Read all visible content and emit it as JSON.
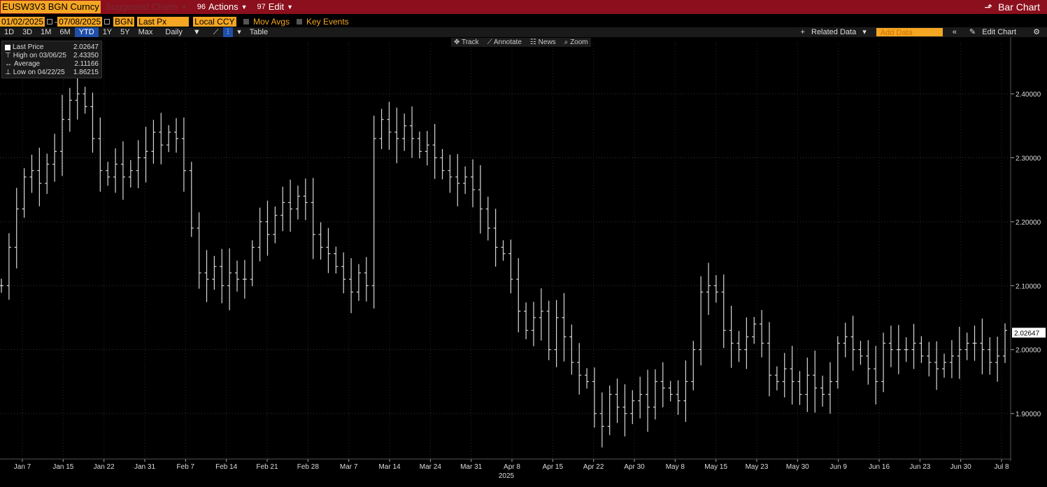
{
  "titlebar": {
    "security": "EUSW3V3 BGN Curncy",
    "suggested": "Suggested Charts",
    "actions_num": "96",
    "actions": "Actions",
    "edit_num": "97",
    "edit": "Edit",
    "bar_chart": "Bar Chart"
  },
  "controls": {
    "start_date": "01/02/2025",
    "end_date": "07/08/2025",
    "source": "BGN",
    "field": "Last Px",
    "currency": "Local CCY",
    "mov_avgs": "Mov Avgs",
    "key_events": "Key Events"
  },
  "periods": [
    "1D",
    "3D",
    "1M",
    "6M",
    "YTD",
    "1Y",
    "5Y",
    "Max"
  ],
  "active_period": "YTD",
  "frequency": "Daily",
  "table_label": "Table",
  "related_data": "Related Data",
  "add_data_placeholder": "Add Data",
  "edit_chart": "Edit Chart",
  "chart_tools": [
    "Track",
    "Annotate",
    "News",
    "Zoom"
  ],
  "legend": {
    "last_label": "Last Price",
    "last_value": "2.02647",
    "high_label": "High on 03/06/25",
    "high_value": "2.43350",
    "avg_label": "Average",
    "avg_value": "2.11166",
    "low_label": "Low on 04/22/25",
    "low_value": "1.86215"
  },
  "colors": {
    "title_bar": "#8b0f1c",
    "accent": "#f5a623",
    "bars": "#d8d8d8",
    "active_tab": "#1f4fa8"
  },
  "chart_data": {
    "type": "bar",
    "style": "ohlc",
    "ylim": [
      1.83,
      2.48
    ],
    "yticks": [
      "1.90000",
      "2.00000",
      "2.10000",
      "2.20000",
      "2.30000",
      "2.40000"
    ],
    "last_price_label": "2.02647",
    "xlabels": [
      "Jan 7",
      "Jan 15",
      "Jan 22",
      "Jan 31",
      "Feb 7",
      "Feb 14",
      "Feb 21",
      "Feb 28",
      "Mar 7",
      "Mar 14",
      "Mar 24",
      "Mar 31",
      "Apr 8",
      "Apr 15",
      "Apr 22",
      "Apr 30",
      "May 8",
      "May 15",
      "May 23",
      "May 30",
      "Jun 9",
      "Jun 16",
      "Jun 23",
      "Jun 30",
      "Jul 8"
    ],
    "year_label": "2025",
    "grid": true,
    "closes": [
      2.1,
      2.16,
      2.22,
      2.27,
      2.28,
      2.26,
      2.29,
      2.31,
      2.36,
      2.39,
      2.4,
      2.38,
      2.33,
      2.28,
      2.27,
      2.29,
      2.27,
      2.28,
      2.3,
      2.31,
      2.34,
      2.32,
      2.34,
      2.33,
      2.28,
      2.19,
      2.12,
      2.11,
      2.13,
      2.1,
      2.12,
      2.11,
      2.11,
      2.16,
      2.2,
      2.18,
      2.21,
      2.23,
      2.22,
      2.24,
      2.23,
      2.18,
      2.16,
      2.15,
      2.13,
      2.11,
      2.09,
      2.12,
      2.1,
      2.33,
      2.36,
      2.34,
      2.33,
      2.35,
      2.33,
      2.31,
      2.32,
      2.3,
      2.28,
      2.27,
      2.26,
      2.27,
      2.25,
      2.22,
      2.19,
      2.16,
      2.15,
      2.11,
      2.06,
      2.03,
      2.05,
      2.06,
      2.0,
      2.05,
      2.02,
      1.98,
      1.96,
      1.95,
      1.9,
      1.88,
      1.93,
      1.91,
      1.9,
      1.92,
      1.93,
      1.91,
      1.95,
      1.94,
      1.93,
      1.92,
      1.95,
      2.0,
      2.09,
      2.1,
      2.09,
      2.03,
      2.01,
      2.0,
      2.02,
      2.04,
      2.01,
      1.96,
      1.95,
      1.97,
      1.95,
      1.93,
      1.96,
      1.94,
      1.93,
      1.95,
      2.01,
      2.02,
      2.0,
      1.99,
      1.97,
      1.95,
      2.01,
      2.0,
      2.0,
      2.0,
      2.01,
      1.99,
      1.98,
      1.97,
      1.98,
      1.99,
      2.0,
      2.01,
      2.01,
      2.0,
      1.98,
      1.99,
      2.03
    ]
  }
}
